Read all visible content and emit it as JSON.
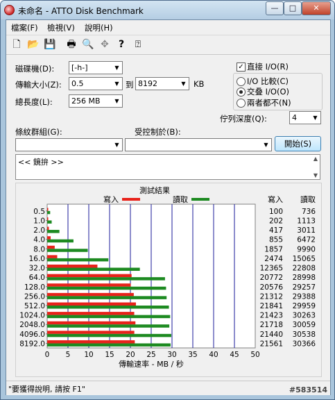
{
  "window": {
    "title": "未命名 - ATTO Disk Benchmark",
    "minimize_glyph": "—",
    "maximize_glyph": "□",
    "close_glyph": "✕"
  },
  "menu": [
    "檔案(F)",
    "檢視(V)",
    "說明(H)"
  ],
  "toolbar": {
    "icons": [
      "new-file-icon",
      "open-folder-icon",
      "save-icon",
      "print-icon",
      "print-preview-icon",
      "move-icon",
      "help-icon",
      "context-help-icon"
    ],
    "glyphs": [
      "🗋",
      "📂",
      "💾",
      "🖶",
      "🔍",
      "✥",
      "?",
      "⍰"
    ]
  },
  "form": {
    "drive_label": "磁碟機(D):",
    "drive_value": "[-h-]",
    "transfer_label": "傳輸大小(Z):",
    "transfer_from": "0.5",
    "to_label": "到",
    "transfer_to": "8192",
    "kb_label": "KB",
    "length_label": "總長度(L):",
    "length_value": "256 MB",
    "direct_io_label": "直接 I/O(R)",
    "direct_io_checked": true,
    "radio_compare": "I/O 比較(C)",
    "radio_overlap": "交叠 I/O(O)",
    "radio_neither": "兩者都不(N)",
    "queue_label": "佇列深度(Q):",
    "queue_value": "4",
    "pattern_label": "條紋群組(G):",
    "controlled_label": "受控制於(B):",
    "start_button": "開始(S)",
    "description": "<< 鏡拚 >>"
  },
  "status": {
    "text": "\"要獲得說明, 請按 F1\"",
    "watermark": "#583514"
  },
  "chart_data": {
    "type": "bar",
    "title": "測試結果",
    "legend": [
      "寫入",
      "讀取"
    ],
    "legend_placement": "top",
    "xlabel": "傳輸速率 - MB / 秒",
    "xlim": [
      0,
      50
    ],
    "xticks": [
      "0",
      "5",
      "10",
      "15",
      "20",
      "25",
      "30",
      "35",
      "40",
      "45",
      "50"
    ],
    "grid": true,
    "categories": [
      "0.5",
      "1.0",
      "2.0",
      "4.0",
      "8.0",
      "16.0",
      "32.0",
      "64.0",
      "128.0",
      "256.0",
      "512.0",
      "1024.0",
      "2048.0",
      "4096.0",
      "8192.0"
    ],
    "col_write_header": "寫入",
    "col_read_header": "讀取",
    "series": [
      {
        "name": "寫入",
        "color": "#e8221a",
        "values": [
          100,
          202,
          417,
          855,
          1857,
          2474,
          12365,
          20772,
          20576,
          21312,
          21841,
          21423,
          21718,
          21440,
          21561
        ]
      },
      {
        "name": "讀取",
        "color": "#1d8a21",
        "values": [
          736,
          1113,
          3011,
          6472,
          9990,
          15065,
          22808,
          28998,
          29257,
          29388,
          29959,
          30263,
          30059,
          30538,
          30366
        ]
      }
    ]
  }
}
